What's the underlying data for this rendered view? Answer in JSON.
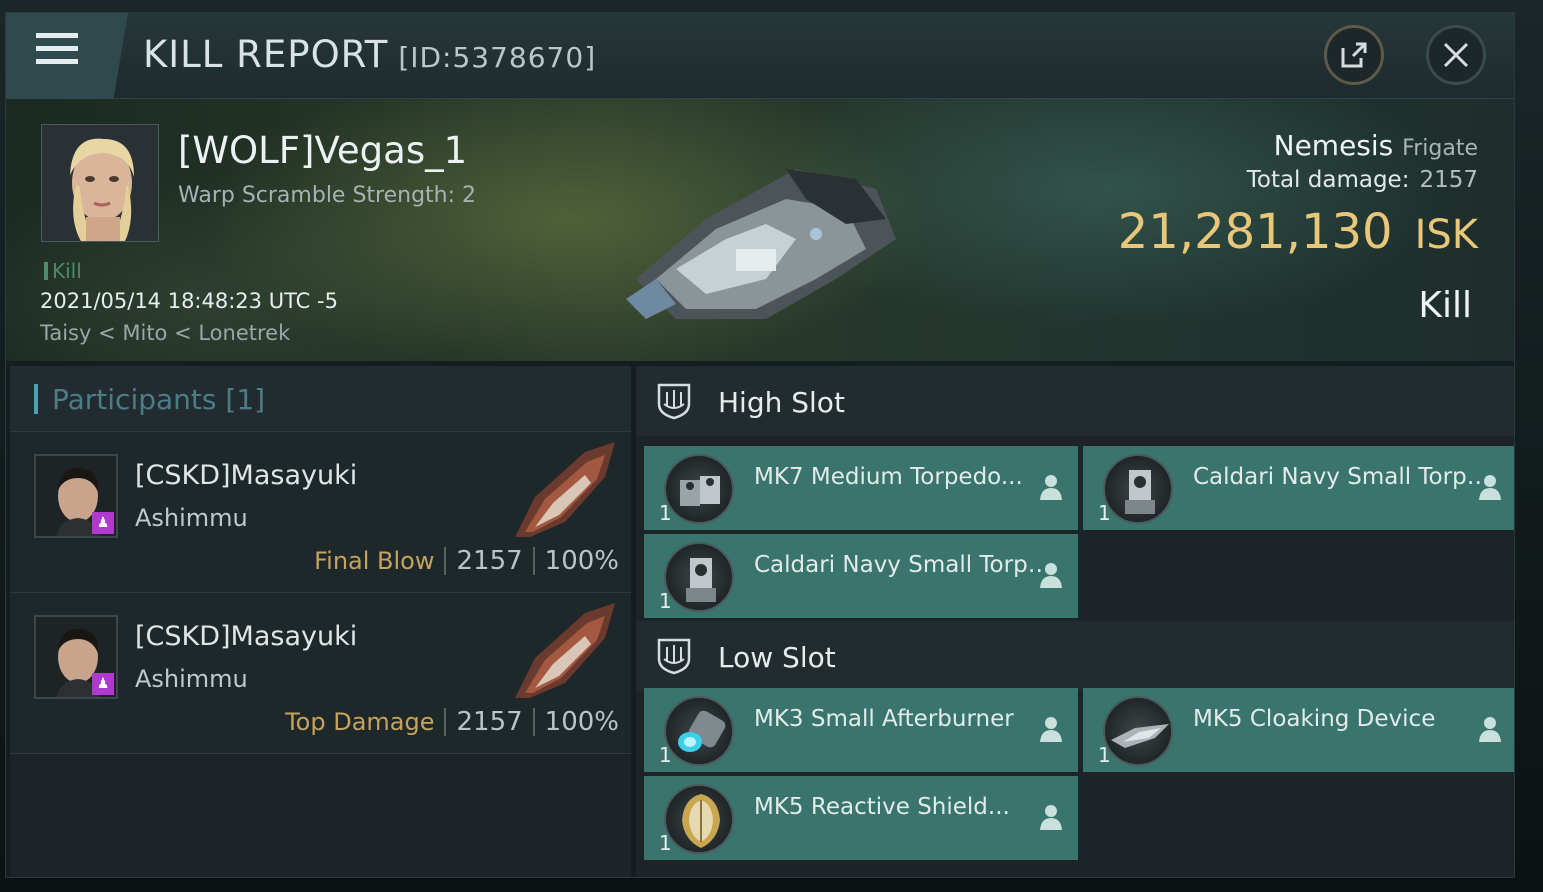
{
  "window": {
    "title": "KILL REPORT",
    "report_id": "[ID:5378670]"
  },
  "victim": {
    "name": "[WOLF]Vegas_1",
    "subtitle": "Warp Scramble Strength: 2",
    "tag": "Kill",
    "time": "2021/05/14 18:48:23 UTC -5",
    "location": "Taisy < Mito < Lonetrek"
  },
  "ship": {
    "name": "Nemesis",
    "class": "Frigate",
    "total_damage_label": "Total damage:",
    "total_damage": "2157",
    "isk_value": "21,281,130",
    "isk_unit": "ISK",
    "result": "Kill"
  },
  "participants": {
    "title": "Participants",
    "count": "[1]",
    "rows": [
      {
        "name": "[CSKD]Masayuki",
        "ship": "Ashimmu",
        "role": "Final Blow",
        "damage": "2157",
        "percent": "100%"
      },
      {
        "name": "[CSKD]Masayuki",
        "ship": "Ashimmu",
        "role": "Top Damage",
        "damage": "2157",
        "percent": "100%"
      }
    ]
  },
  "fittings": {
    "high_slot": {
      "title": "High Slot",
      "modules": [
        {
          "name": "MK7 Medium Torpedo...",
          "qty": "1",
          "icon": "torpedo-launcher-icon"
        },
        {
          "name": "Caldari Navy Small Torpedo ...",
          "qty": "1",
          "icon": "torpedo-launcher-icon"
        },
        {
          "name": "Caldari Navy Small Torpedo ...",
          "qty": "1",
          "icon": "torpedo-launcher-icon"
        }
      ]
    },
    "low_slot": {
      "title": "Low Slot",
      "modules": [
        {
          "name": "MK3 Small Afterburner",
          "qty": "1",
          "icon": "afterburner-icon"
        },
        {
          "name": "MK5 Cloaking Device",
          "qty": "1",
          "icon": "cloaking-device-icon"
        },
        {
          "name": "MK5 Reactive Shield...",
          "qty": "1",
          "icon": "shield-icon"
        }
      ]
    }
  },
  "colors": {
    "accent": "#39756c",
    "isk": "#e8c77a",
    "role": "#c5a25e"
  }
}
